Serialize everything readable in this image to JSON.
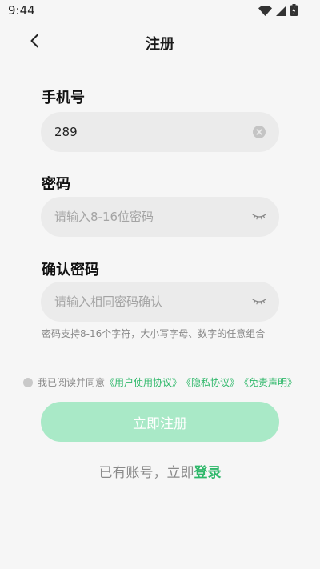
{
  "status_bar": {
    "time": "9:44",
    "icons": [
      "wifi-icon",
      "signal-icon",
      "battery-icon"
    ]
  },
  "header": {
    "back_icon": "chevron-left-icon",
    "title": "注册"
  },
  "form": {
    "phone": {
      "label": "手机号",
      "value": "289",
      "clear_icon": "clear-icon"
    },
    "password": {
      "label": "密码",
      "placeholder": "请输入8-16位密码",
      "toggle_icon": "eye-closed-icon"
    },
    "confirm_password": {
      "label": "确认密码",
      "placeholder": "请输入相同密码确认",
      "toggle_icon": "eye-closed-icon"
    },
    "hint": "密码支持8-16个字符，大小写字母、数字的任意组合"
  },
  "agreement": {
    "text": "我已阅读并同意",
    "links": [
      "《用户使用协议》",
      "《隐私协议》",
      "《免责声明》"
    ]
  },
  "submit_label": "立即注册",
  "login": {
    "prompt": "已有账号，立即",
    "link": "登录"
  },
  "colors": {
    "accent": "#2fb86a",
    "button_disabled": "#a9e9c7",
    "field_bg": "#ebebeb",
    "page_bg": "#f6f6f6"
  }
}
